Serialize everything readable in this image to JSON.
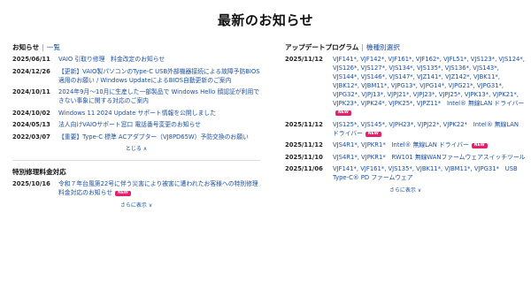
{
  "page": {
    "title": "最新のお知らせ"
  },
  "left": {
    "heading": "お知らせ",
    "sep": "|",
    "link": "一覧",
    "items": [
      {
        "date": "2025/06/11",
        "text": "VAIO 引取り修理　料金改定のお知らせ"
      },
      {
        "date": "2024/12/26",
        "text": "【更新】VAIO製パソコンのType-C USB外部機器接続による故障予防BIOS適用のお願い / Windows UpdateによるBIOS自動更新のご案内"
      },
      {
        "date": "2024/10/11",
        "text": "2024年9月～10月に生産した一部製品で Windows Hello 顔認証が利用できない事象に関する対応のご案内"
      },
      {
        "date": "2024/10/02",
        "text": "Windows 11 2024 Update サポート情報を公開しました"
      },
      {
        "date": "2024/05/13",
        "text": "法人向けVAIOサポート窓口 電話番号変更のお知らせ"
      },
      {
        "date": "2022/03/07",
        "text": "【重要】Type-C 標準 ACアダプター（VJ8PD65W）予防交換のお願い"
      }
    ],
    "collapse": "とじる ∧",
    "special_heading": "特別修理料金対応",
    "special_items": [
      {
        "date": "2025/10/16",
        "text": "令和７年台風第22号に伴う災害により被害に遭われたお客様への特別修理料金対応のお知らせ",
        "badge": "NEW"
      }
    ],
    "more": "さらに表示 ∨"
  },
  "right": {
    "heading": "アップデートプログラム",
    "sep": "|",
    "link": "機種別選択",
    "items": [
      {
        "date": "2025/11/12",
        "text": "VJF141*, VJF142*, VJF161*, VJF162*, VJFL51*, VJS123*, VJS124*, VJS126*, VJS127*, VJS134*, VJS135*, VJS136*, VJS143*, VJS144*, VJS146*, VJS147*, VJZ141*, VJZ142*, VJBK11*, VJBK12*, VJBM11*, VJPG13*, VJPG14*, VJPG21*, VJPG31*, VJPG32*, VJPJ13*, VJPJ21*, VJPJ23*, VJPJ25*, VJPK13*, VJPK21*, VJPK23*, VJPK24*, VJPK25*, VJPZ11*　Intel® 無線LAN ドライバー",
        "badge": "NEW"
      },
      {
        "date": "2025/11/12",
        "text": "VJS125*, VJS145*, VJPH23*, VJPJ22*, VJPK22*　Intel® 無線LAN ドライバー",
        "badge": "NEW"
      },
      {
        "date": "2025/11/12",
        "text": "VJS4R1*, VJPKR1*　Intel® 無線LAN ドライバー",
        "badge": "NEW"
      },
      {
        "date": "2025/11/10",
        "text": "VJS4R1*, VJPKR1*　RW101 無線WANファームウェアスイッチツール",
        "badge": ""
      },
      {
        "date": "2025/11/06",
        "text": "VJF141*, VJF161*, VJS135*, VJBK11*, VJBM11*, VJPG31*　USB Type-C® PD ファームウェア",
        "badge": ""
      }
    ],
    "more": "さらに表示 ∨"
  }
}
